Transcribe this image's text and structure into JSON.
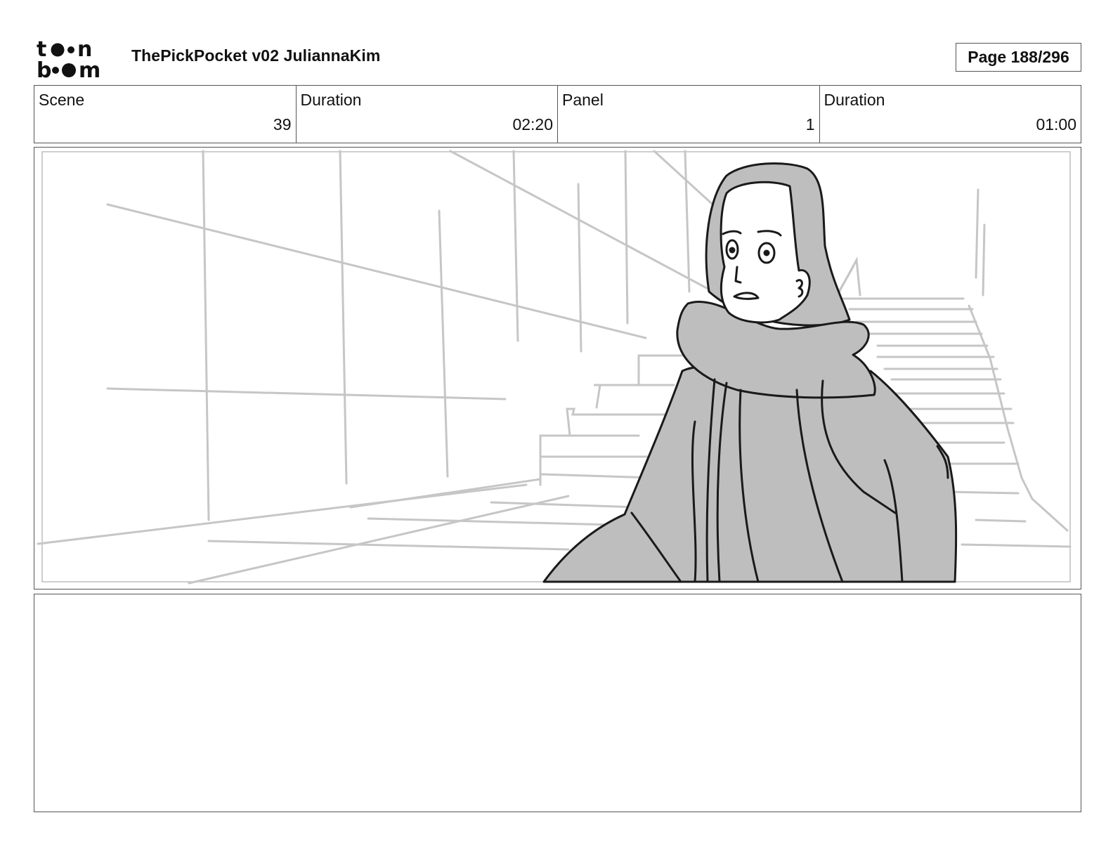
{
  "header": {
    "logo_text": "toon boom",
    "title": "ThePickPocket v02 JuliannaKim",
    "page_label": "Page 188/296"
  },
  "info": {
    "scene_label": "Scene",
    "scene_value": "39",
    "scene_duration_label": "Duration",
    "scene_duration_value": "02:20",
    "panel_label": "Panel",
    "panel_value": "1",
    "panel_duration_label": "Duration",
    "panel_duration_value": "01:00"
  },
  "panel": {
    "image_icon": "storyboard-sketch",
    "line_color": "#c4c4c4",
    "figure_fill": "#bebebe",
    "ink_color": "#1a1a1a"
  },
  "notes": {
    "text": ""
  }
}
